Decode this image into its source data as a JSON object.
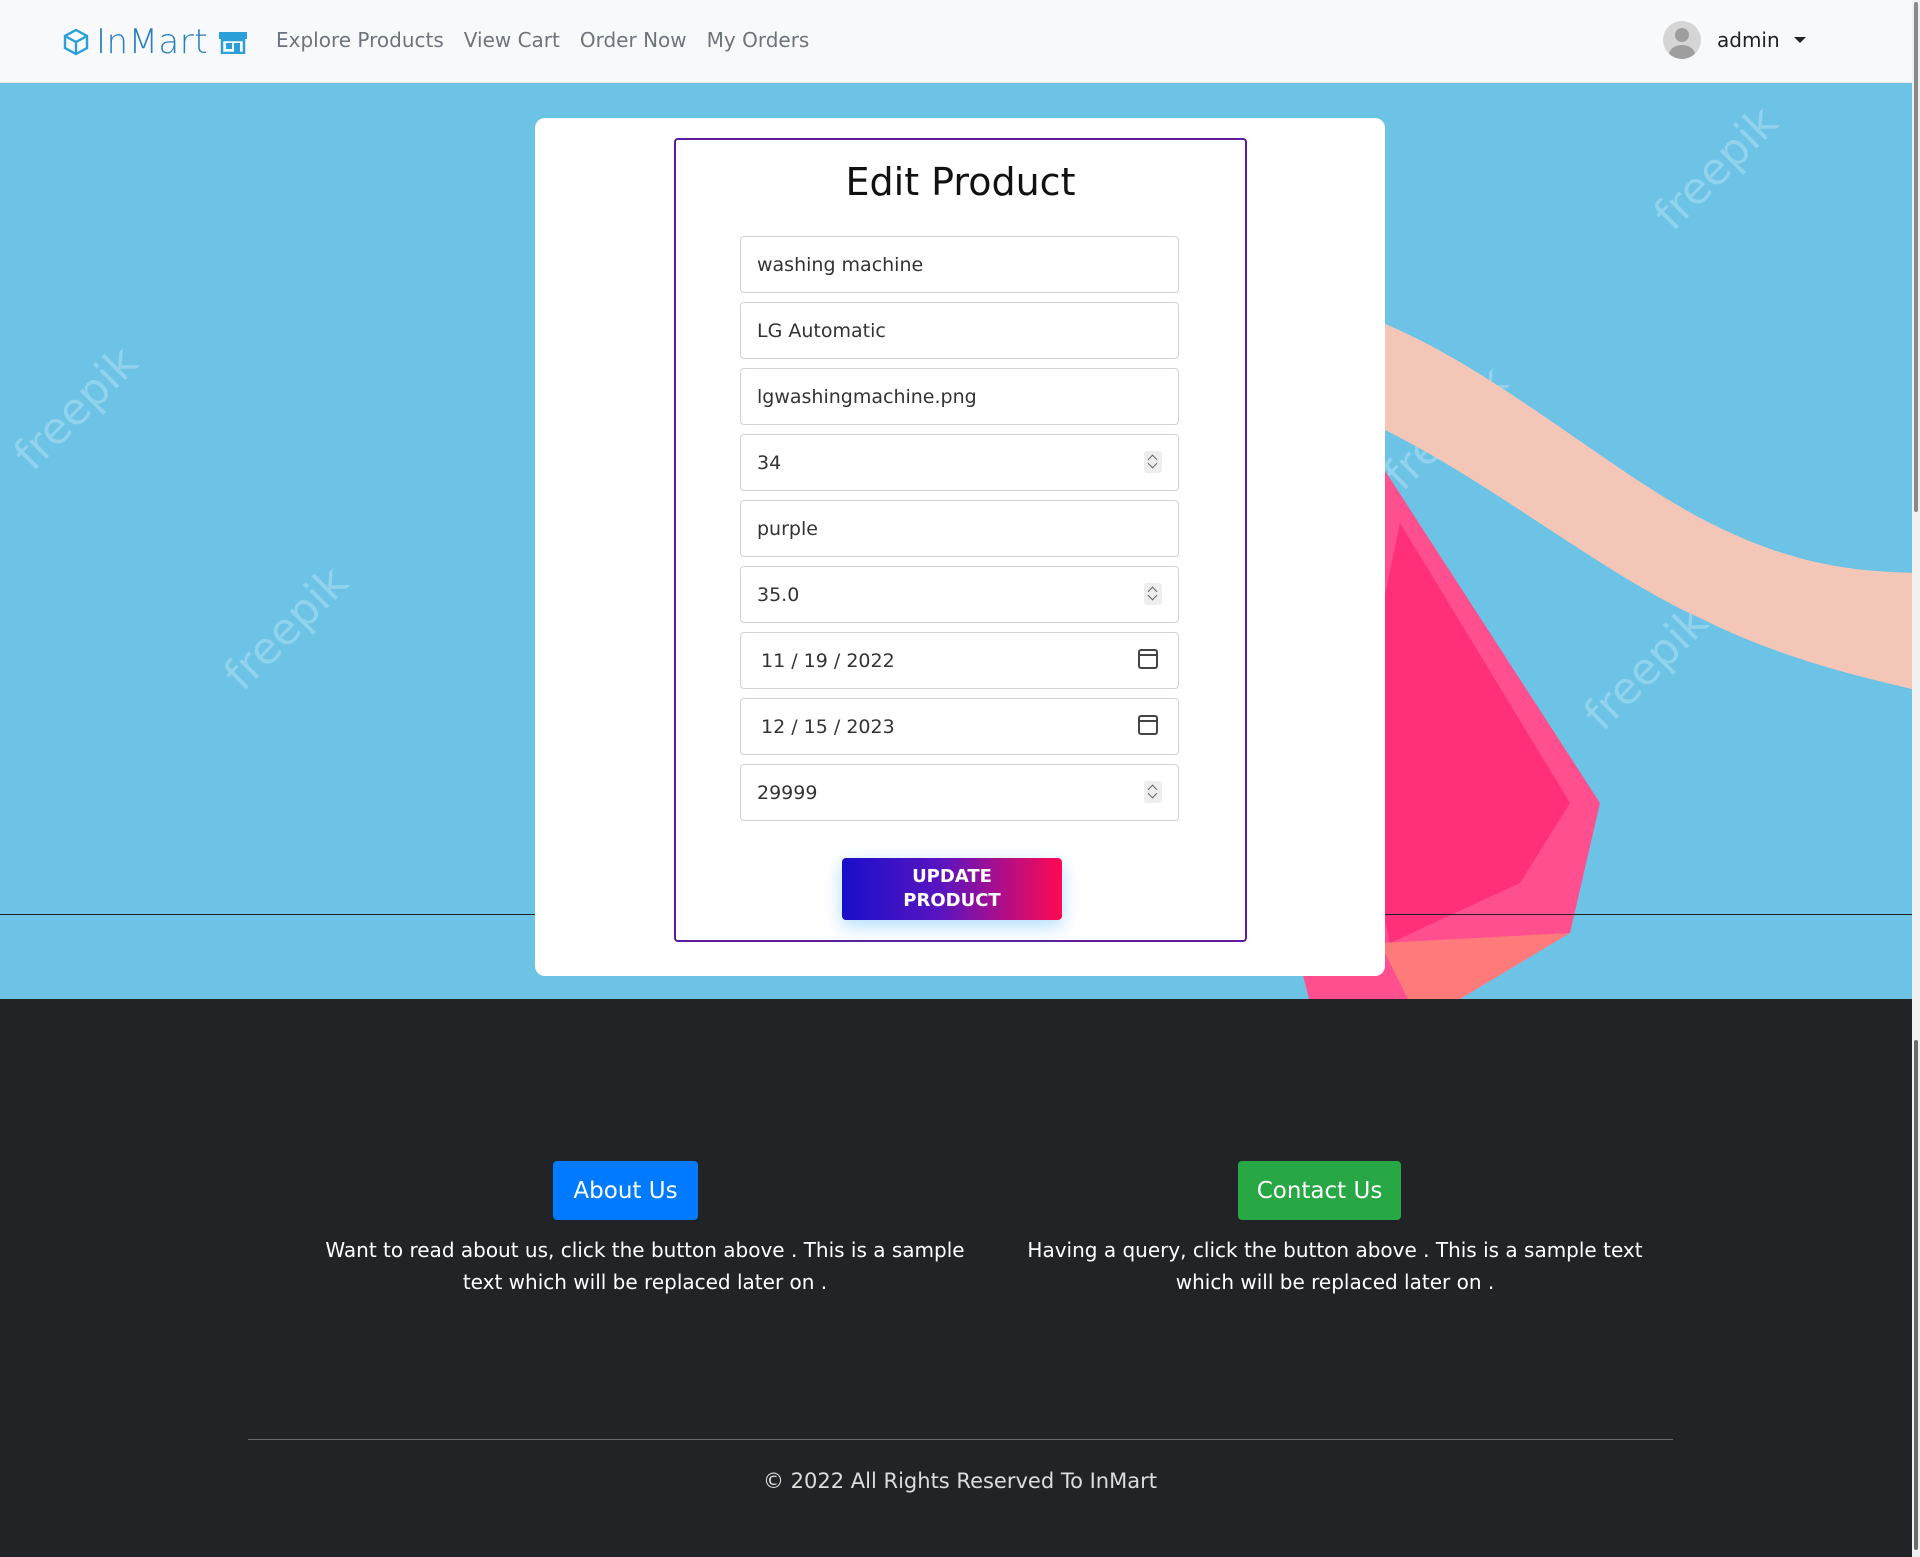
{
  "navbar": {
    "brand": "InMart",
    "links": [
      "Explore Products",
      "View Cart",
      "Order Now",
      "My Orders"
    ],
    "user": "admin"
  },
  "form": {
    "title": "Edit Product",
    "fields": {
      "name": "washing machine",
      "description": "LG Automatic",
      "image": "lgwashingmachine.png",
      "quantity": "34",
      "color": "purple",
      "discount": "35.0",
      "manufacture_date": "11 / 19 / 2022",
      "expiry_date": "12 / 15 / 2023",
      "price": "29999"
    },
    "submit_line1": "UPDATE",
    "submit_line2": "PRODUCT"
  },
  "footer": {
    "about_label": "About Us",
    "about_text": "Want to read about us, click the button above . This is a sample text which will be replaced later on .",
    "contact_label": "Contact Us",
    "contact_text": "Having a query, click the button above . This is a sample text which will be replaced later on .",
    "copyright": "© 2022 All Rights Reserved To InMart"
  },
  "hero": {
    "watermark": "freepik"
  },
  "colors": {
    "hero_bg": "#6cc3e6",
    "footer_bg": "#222326",
    "about_btn": "#007bff",
    "contact_btn": "#28a745",
    "form_border": "#5b1d9c",
    "update_gradient": [
      "#1810c9",
      "#ff0a52"
    ]
  },
  "icons": [
    "cube-logo-icon",
    "store-icon",
    "avatar-icon",
    "caret-down-icon",
    "calendar-icon",
    "spinner-icon"
  ]
}
